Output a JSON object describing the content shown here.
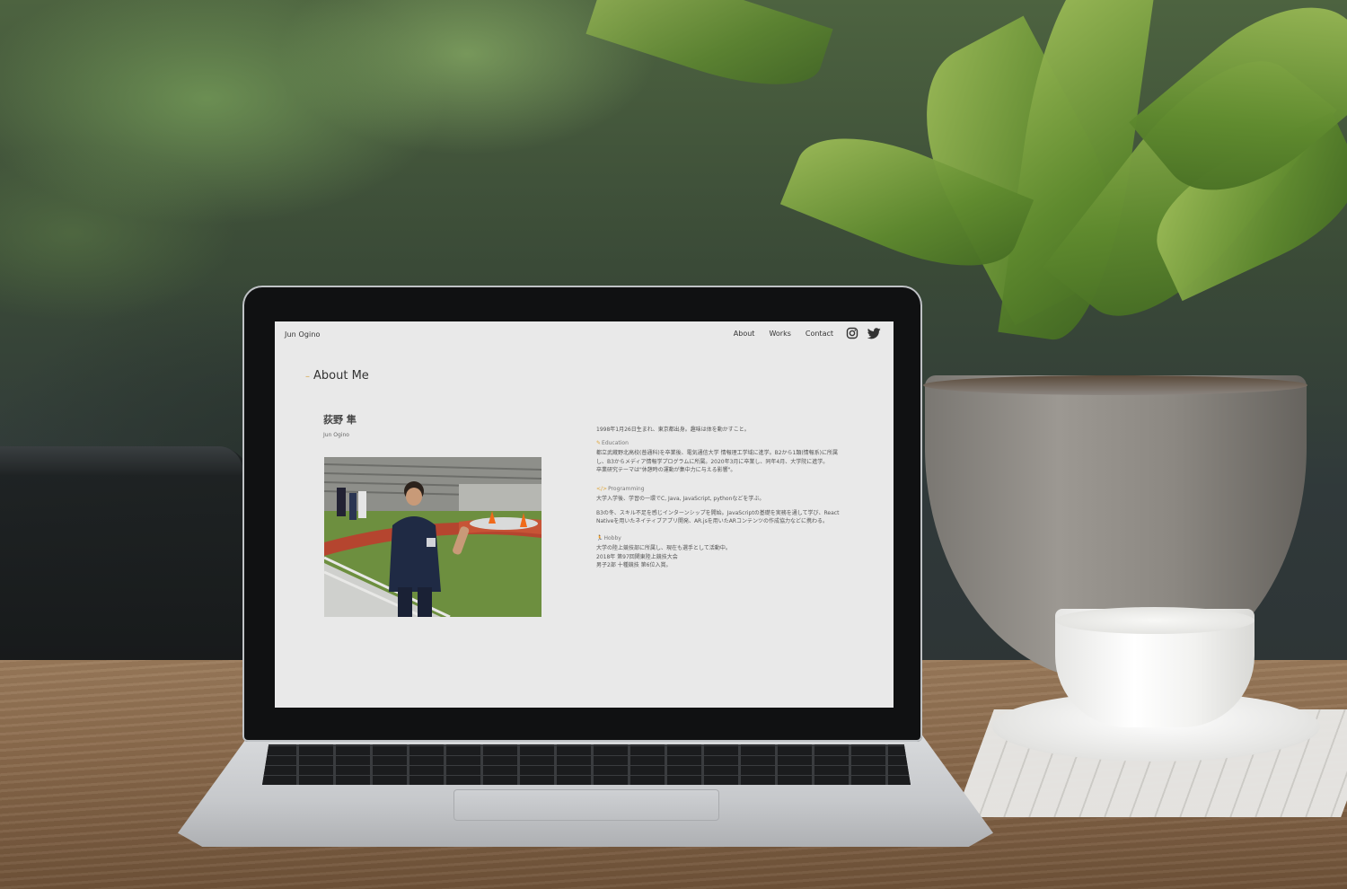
{
  "site": {
    "logo": "Jun Ogino",
    "nav": {
      "items": [
        {
          "label": "About"
        },
        {
          "label": "Works"
        },
        {
          "label": "Contact"
        }
      ],
      "social": [
        {
          "icon": "instagram-icon"
        },
        {
          "icon": "twitter-icon"
        }
      ]
    }
  },
  "about": {
    "title": "About Me",
    "name": "荻野 隼",
    "name_romaji": "Jun Ogino",
    "intro": "1998年1月26日生まれ、東京都出身。趣味は体を動かすこと。",
    "sections": [
      {
        "heading": "Education",
        "icon": "pencil-icon",
        "lines": [
          "都立武蔵野北高校(普通科)を卒業後、電気通信大学 情報理工学域に進学。B2から1類(情報系)に所属",
          "し、B3からメディア情報学プログラムに所属。2020年3月に卒業し、同年4月、大学院に進学。",
          "卒業研究テーマは\"休憩時の運動が集中力に与える影響\"。"
        ]
      },
      {
        "heading": "Programming",
        "icon": "code-icon",
        "lines": [
          "大学入学後、学習の一環でC, Java, JavaScript, pythonなどを学ぶ。",
          "",
          "B3の冬、スキル不足を感じインターンシップを開始。JavaScriptの基礎を実務を通して学び、React",
          "Nativeを用いたネイティブアプリ開発、AR.jsを用いたARコンテンツの作成協力などに携わる。"
        ]
      },
      {
        "heading": "Hobby",
        "icon": "runner-icon",
        "lines": [
          "大学の陸上競技部に所属し、現在も選手として活動中。",
          "2018年 第97回関東陸上競技大会",
          "男子2部 十種競技 第6位入賞。"
        ]
      }
    ]
  },
  "colors": {
    "screen_bg": "#e9e9e9",
    "accent": "#d6a54a"
  }
}
